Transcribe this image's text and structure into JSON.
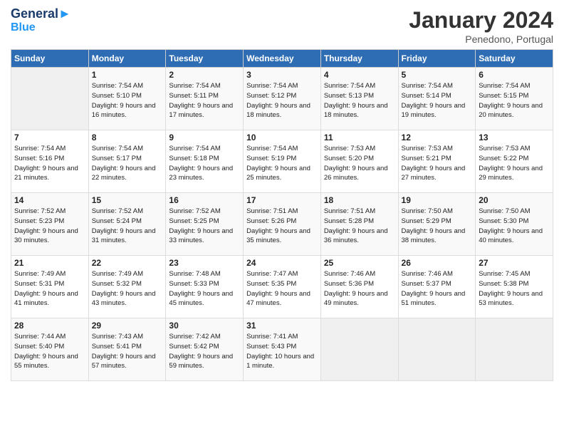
{
  "header": {
    "logo_line1": "General",
    "logo_line2": "Blue",
    "month_title": "January 2024",
    "subtitle": "Penedono, Portugal"
  },
  "columns": [
    "Sunday",
    "Monday",
    "Tuesday",
    "Wednesday",
    "Thursday",
    "Friday",
    "Saturday"
  ],
  "weeks": [
    [
      {
        "day": "",
        "sunrise": "",
        "sunset": "",
        "daylight": ""
      },
      {
        "day": "1",
        "sunrise": "Sunrise: 7:54 AM",
        "sunset": "Sunset: 5:10 PM",
        "daylight": "Daylight: 9 hours and 16 minutes."
      },
      {
        "day": "2",
        "sunrise": "Sunrise: 7:54 AM",
        "sunset": "Sunset: 5:11 PM",
        "daylight": "Daylight: 9 hours and 17 minutes."
      },
      {
        "day": "3",
        "sunrise": "Sunrise: 7:54 AM",
        "sunset": "Sunset: 5:12 PM",
        "daylight": "Daylight: 9 hours and 18 minutes."
      },
      {
        "day": "4",
        "sunrise": "Sunrise: 7:54 AM",
        "sunset": "Sunset: 5:13 PM",
        "daylight": "Daylight: 9 hours and 18 minutes."
      },
      {
        "day": "5",
        "sunrise": "Sunrise: 7:54 AM",
        "sunset": "Sunset: 5:14 PM",
        "daylight": "Daylight: 9 hours and 19 minutes."
      },
      {
        "day": "6",
        "sunrise": "Sunrise: 7:54 AM",
        "sunset": "Sunset: 5:15 PM",
        "daylight": "Daylight: 9 hours and 20 minutes."
      }
    ],
    [
      {
        "day": "7",
        "sunrise": "Sunrise: 7:54 AM",
        "sunset": "Sunset: 5:16 PM",
        "daylight": "Daylight: 9 hours and 21 minutes."
      },
      {
        "day": "8",
        "sunrise": "Sunrise: 7:54 AM",
        "sunset": "Sunset: 5:17 PM",
        "daylight": "Daylight: 9 hours and 22 minutes."
      },
      {
        "day": "9",
        "sunrise": "Sunrise: 7:54 AM",
        "sunset": "Sunset: 5:18 PM",
        "daylight": "Daylight: 9 hours and 23 minutes."
      },
      {
        "day": "10",
        "sunrise": "Sunrise: 7:54 AM",
        "sunset": "Sunset: 5:19 PM",
        "daylight": "Daylight: 9 hours and 25 minutes."
      },
      {
        "day": "11",
        "sunrise": "Sunrise: 7:53 AM",
        "sunset": "Sunset: 5:20 PM",
        "daylight": "Daylight: 9 hours and 26 minutes."
      },
      {
        "day": "12",
        "sunrise": "Sunrise: 7:53 AM",
        "sunset": "Sunset: 5:21 PM",
        "daylight": "Daylight: 9 hours and 27 minutes."
      },
      {
        "day": "13",
        "sunrise": "Sunrise: 7:53 AM",
        "sunset": "Sunset: 5:22 PM",
        "daylight": "Daylight: 9 hours and 29 minutes."
      }
    ],
    [
      {
        "day": "14",
        "sunrise": "Sunrise: 7:52 AM",
        "sunset": "Sunset: 5:23 PM",
        "daylight": "Daylight: 9 hours and 30 minutes."
      },
      {
        "day": "15",
        "sunrise": "Sunrise: 7:52 AM",
        "sunset": "Sunset: 5:24 PM",
        "daylight": "Daylight: 9 hours and 31 minutes."
      },
      {
        "day": "16",
        "sunrise": "Sunrise: 7:52 AM",
        "sunset": "Sunset: 5:25 PM",
        "daylight": "Daylight: 9 hours and 33 minutes."
      },
      {
        "day": "17",
        "sunrise": "Sunrise: 7:51 AM",
        "sunset": "Sunset: 5:26 PM",
        "daylight": "Daylight: 9 hours and 35 minutes."
      },
      {
        "day": "18",
        "sunrise": "Sunrise: 7:51 AM",
        "sunset": "Sunset: 5:28 PM",
        "daylight": "Daylight: 9 hours and 36 minutes."
      },
      {
        "day": "19",
        "sunrise": "Sunrise: 7:50 AM",
        "sunset": "Sunset: 5:29 PM",
        "daylight": "Daylight: 9 hours and 38 minutes."
      },
      {
        "day": "20",
        "sunrise": "Sunrise: 7:50 AM",
        "sunset": "Sunset: 5:30 PM",
        "daylight": "Daylight: 9 hours and 40 minutes."
      }
    ],
    [
      {
        "day": "21",
        "sunrise": "Sunrise: 7:49 AM",
        "sunset": "Sunset: 5:31 PM",
        "daylight": "Daylight: 9 hours and 41 minutes."
      },
      {
        "day": "22",
        "sunrise": "Sunrise: 7:49 AM",
        "sunset": "Sunset: 5:32 PM",
        "daylight": "Daylight: 9 hours and 43 minutes."
      },
      {
        "day": "23",
        "sunrise": "Sunrise: 7:48 AM",
        "sunset": "Sunset: 5:33 PM",
        "daylight": "Daylight: 9 hours and 45 minutes."
      },
      {
        "day": "24",
        "sunrise": "Sunrise: 7:47 AM",
        "sunset": "Sunset: 5:35 PM",
        "daylight": "Daylight: 9 hours and 47 minutes."
      },
      {
        "day": "25",
        "sunrise": "Sunrise: 7:46 AM",
        "sunset": "Sunset: 5:36 PM",
        "daylight": "Daylight: 9 hours and 49 minutes."
      },
      {
        "day": "26",
        "sunrise": "Sunrise: 7:46 AM",
        "sunset": "Sunset: 5:37 PM",
        "daylight": "Daylight: 9 hours and 51 minutes."
      },
      {
        "day": "27",
        "sunrise": "Sunrise: 7:45 AM",
        "sunset": "Sunset: 5:38 PM",
        "daylight": "Daylight: 9 hours and 53 minutes."
      }
    ],
    [
      {
        "day": "28",
        "sunrise": "Sunrise: 7:44 AM",
        "sunset": "Sunset: 5:40 PM",
        "daylight": "Daylight: 9 hours and 55 minutes."
      },
      {
        "day": "29",
        "sunrise": "Sunrise: 7:43 AM",
        "sunset": "Sunset: 5:41 PM",
        "daylight": "Daylight: 9 hours and 57 minutes."
      },
      {
        "day": "30",
        "sunrise": "Sunrise: 7:42 AM",
        "sunset": "Sunset: 5:42 PM",
        "daylight": "Daylight: 9 hours and 59 minutes."
      },
      {
        "day": "31",
        "sunrise": "Sunrise: 7:41 AM",
        "sunset": "Sunset: 5:43 PM",
        "daylight": "Daylight: 10 hours and 1 minute."
      },
      {
        "day": "",
        "sunrise": "",
        "sunset": "",
        "daylight": ""
      },
      {
        "day": "",
        "sunrise": "",
        "sunset": "",
        "daylight": ""
      },
      {
        "day": "",
        "sunrise": "",
        "sunset": "",
        "daylight": ""
      }
    ]
  ]
}
